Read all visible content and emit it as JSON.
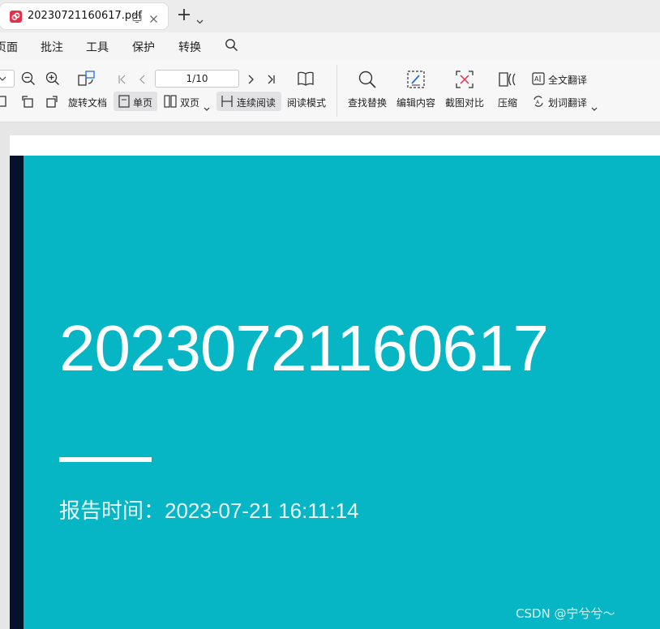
{
  "tab": {
    "title": "20230721160617.pdf"
  },
  "menu": {
    "items": [
      "页面",
      "批注",
      "工具",
      "保护",
      "转换"
    ]
  },
  "toolbar": {
    "page_indicator": "1/10",
    "rotate_label": "旋转文档",
    "single_label": "单页",
    "double_label": "双页",
    "continuous_label": "连续阅读",
    "reading_mode_label": "阅读模式",
    "find_replace_label": "查找替换",
    "edit_content_label": "编辑内容",
    "compare_label": "截图对比",
    "compress_label": "压缩",
    "translate_full_label": "全文翻译",
    "translate_word_label": "划词翻译"
  },
  "document": {
    "cover_number": "20230721160617",
    "report_time": "报告时间：2023-07-21 16:11:14",
    "watermark": "CSDN @宁兮兮～"
  },
  "colors": {
    "cover_bg": "#06b6c5",
    "cover_side": "#06122a",
    "logo_red": "#e5304c"
  }
}
